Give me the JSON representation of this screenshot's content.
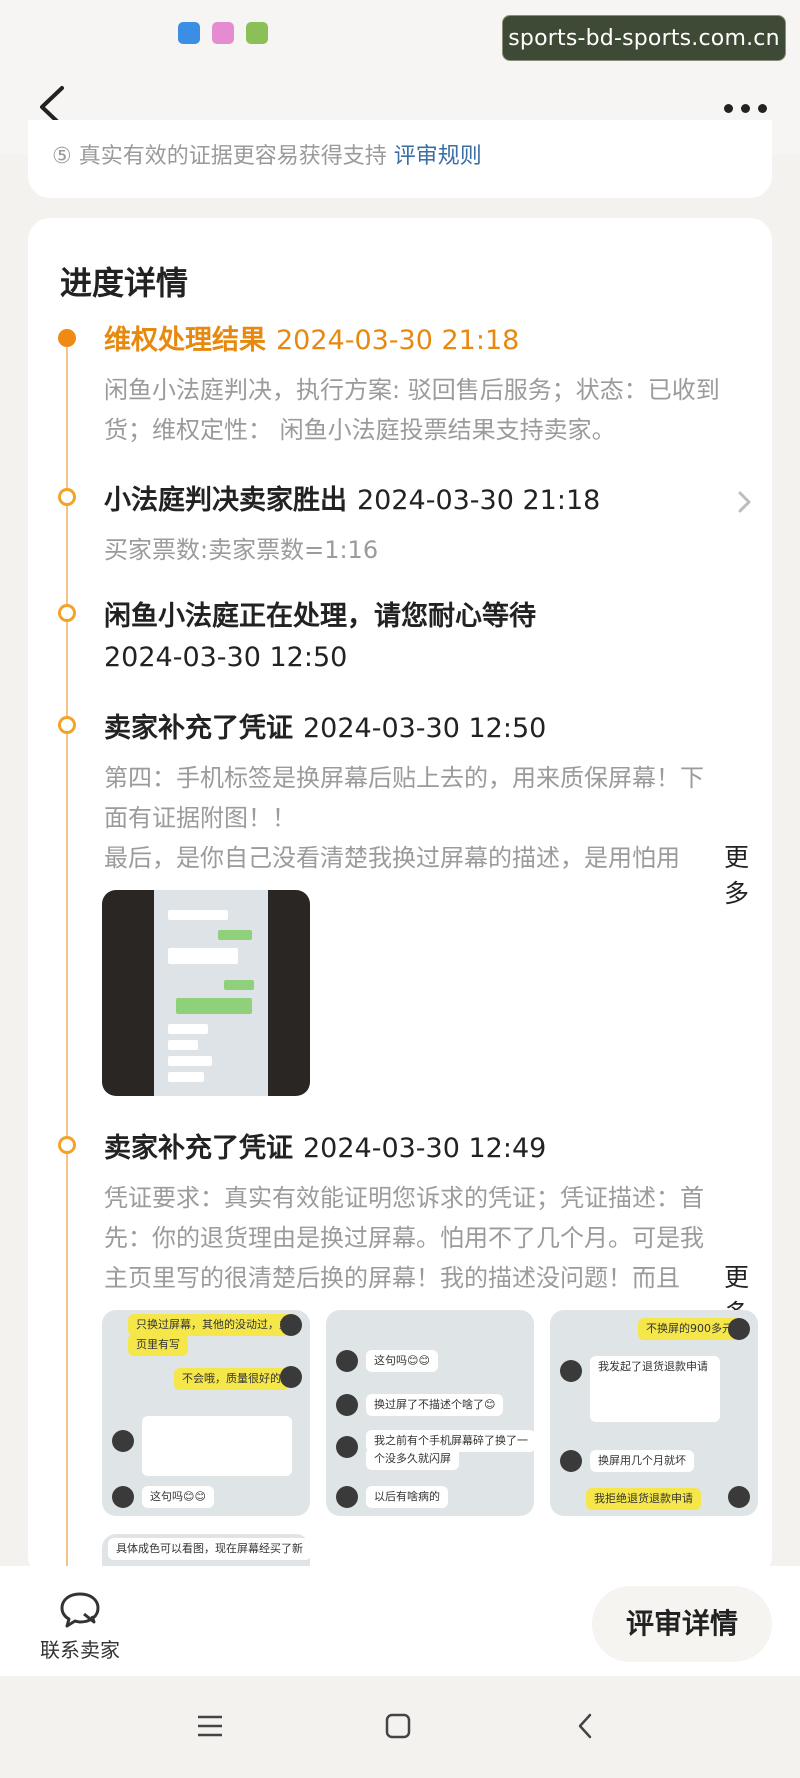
{
  "watermark": "sports-bd-sports.com.cn",
  "status_icons": [
    "app-icon-blue",
    "app-icon-pink",
    "app-icon-green"
  ],
  "nav": {
    "back_icon": "chevron-left-icon",
    "more_icon": "more-dots-icon"
  },
  "prev_card": {
    "hint": "真实有效的证据更容易获得支持",
    "hint_link": "评审规则"
  },
  "progress": {
    "title": "进度详情",
    "items": [
      {
        "title": "维权处理结果",
        "time": "2024-03-30 21:18",
        "body_line1": "闲鱼小法庭判决，执行方案: 驳回售后服务；状态：已收到",
        "body_line2": "货；维权定性： 闲鱼小法庭投票结果支持卖家。"
      },
      {
        "title": "小法庭判决卖家胜出",
        "time": "2024-03-30 21:18",
        "body": "买家票数:卖家票数=1:16"
      },
      {
        "title": "闲鱼小法庭正在处理，请您耐心等待",
        "time": "2024-03-30 12:50"
      },
      {
        "title": "卖家补充了凭证",
        "time": "2024-03-30 12:50",
        "body_line1": "第四：手机标签是换屏幕后贴上去的，用来质保屏幕！下",
        "body_line2": "面有证据附图！！",
        "body_line3": "最后，是你自己没看清楚我换过屏幕的描述，是用怕用",
        "more": "更多"
      },
      {
        "title": "卖家补充了凭证",
        "time": "2024-03-30 12:49",
        "body_line1": "凭证要求：真实有效能证明您诉求的凭证；凭证描述：首",
        "body_line2": "先：你的退货理由是换过屏幕。怕用不了几个月。可是我",
        "body_line3": "主页里写的很清楚后换的屏幕！我的描述没问题！而且",
        "more": "更多"
      }
    ]
  },
  "screenshots": {
    "s1": [
      "只换过屏幕，其他的没动过，主",
      "页里有写",
      "不会哦，质量很好的",
      "这句吗😊😊"
    ],
    "s2": [
      "这句吗😊😊",
      "换过屏了不描述个啥了😊",
      "我之前有个手机屏幕碎了换了一",
      "个没多久就闪屏",
      "以后有啥病的"
    ],
    "s3": [
      "不换屏的900多元",
      "我发起了退货退款申请",
      "换屏用几个月就坏",
      "我拒绝退货退款申请"
    ],
    "s4": [
      "具体成色可以看图，现在屏幕经买了新"
    ]
  },
  "bottom": {
    "contact_label": "联系卖家",
    "contact_icon": "chat-bubble-icon",
    "review_label": "评审详情"
  },
  "colors": {
    "accent": "#e8890f",
    "timeline": "#f3c48a",
    "watermark_bg": "#3f4a36"
  }
}
